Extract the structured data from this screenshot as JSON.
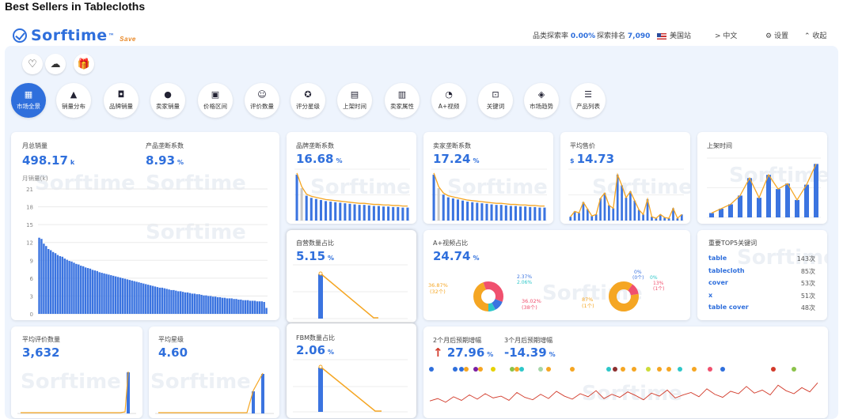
{
  "page": {
    "title": "Best Sellers in Tablecloths"
  },
  "header": {
    "logo_text": "Sorftime",
    "logo_tm": "™",
    "save_tag": "Save",
    "explore_rate_label": "品类探索率",
    "explore_rate_value": "0.00%",
    "explore_rank_label": "探索排名",
    "explore_rank_value": "7,090",
    "marketplace": "美国站",
    "language": "> 中文",
    "settings": "设置",
    "collapse": "收起"
  },
  "quick_icons": [
    "heart-icon",
    "cloud-upload-icon",
    "gift-icon"
  ],
  "nav": {
    "items": [
      {
        "label": "市场全景",
        "icon": "▦"
      },
      {
        "label": "销量分布",
        "icon": "▲"
      },
      {
        "label": "品牌销量",
        "icon": "◘"
      },
      {
        "label": "卖家销量",
        "icon": "●"
      },
      {
        "label": "价格区间",
        "icon": "▣"
      },
      {
        "label": "评价数量",
        "icon": "☺"
      },
      {
        "label": "评分星级",
        "icon": "✪"
      },
      {
        "label": "上架时间",
        "icon": "▤"
      },
      {
        "label": "卖家属性",
        "icon": "▥"
      },
      {
        "label": "A+视频",
        "icon": "◔"
      },
      {
        "label": "关键词",
        "icon": "⊡"
      },
      {
        "label": "市场趋势",
        "icon": "◈"
      },
      {
        "label": "产品列表",
        "icon": "☰"
      }
    ]
  },
  "monthly_sales": {
    "label": "月总销量",
    "value": "498.17",
    "unit": "k",
    "monopoly_label": "产品垄断系数",
    "monopoly_value": "8.93",
    "monopoly_unit": "%",
    "axis_title": "月销量(k)",
    "y_ticks": [
      "21",
      "18",
      "15",
      "12",
      "9",
      "6",
      "3",
      "0"
    ]
  },
  "brand_monopoly": {
    "label": "品牌垄断系数",
    "value": "16.68",
    "unit": "%"
  },
  "seller_monopoly": {
    "label": "卖家垄断系数",
    "value": "17.24",
    "unit": "%"
  },
  "avg_price": {
    "label": "平均售价",
    "currency": "$",
    "value": "14.73"
  },
  "listing_time": {
    "label": "上架时间"
  },
  "self_operated": {
    "label": "自营数量占比",
    "value": "5.15",
    "unit": "%"
  },
  "fbm": {
    "label": "FBM数量占比",
    "value": "2.06",
    "unit": "%"
  },
  "aplus": {
    "label": "A+视频占比",
    "value": "24.74",
    "unit": "%",
    "donut1": {
      "left_pct": "36.87%",
      "left_cnt": "(32个)",
      "right_pct": "36.02%",
      "right_cnt": "(38个)",
      "top_pct": "2.37%",
      "top_cnt": "(2个)",
      "top2_pct": "2.06%",
      "top2_cnt": "(2个)"
    },
    "donut2": {
      "left_pct": "87%",
      "left_cnt": "(1个)",
      "top_pct": "0%",
      "top_cnt": "(0个)",
      "top_r": "0%",
      "top_r_cnt": "(0个)",
      "right_pct": "13%",
      "right_cnt": "(1个)"
    }
  },
  "top_keywords": {
    "label": "重要TOP5关键词",
    "items": [
      {
        "kw": "table",
        "count": "143次"
      },
      {
        "kw": "tablecloth",
        "count": "85次"
      },
      {
        "kw": "cover",
        "count": "53次"
      },
      {
        "kw": "x",
        "count": "51次"
      },
      {
        "kw": "table cover",
        "count": "48次"
      }
    ]
  },
  "avg_reviews": {
    "label": "平均评价数量",
    "value": "3,632"
  },
  "avg_rating": {
    "label": "平均星级",
    "value": "4.60"
  },
  "growth": {
    "label2": "2个月后预期增幅",
    "value2": "27.96",
    "unit2": "%",
    "arrow": "↑",
    "label3": "3个月后预期增幅",
    "value3": "-14.39",
    "unit3": "%"
  },
  "watermark": "Sorftime",
  "colors": {
    "accent": "#2f6fdc",
    "bar": "#3b74e0",
    "line": "#f5a623",
    "red": "#d23a2a",
    "panel": "#eef4fd"
  },
  "chart_data": [
    {
      "type": "bar",
      "title": "月总销量",
      "ylabel": "月销量(k)",
      "ylim": [
        0,
        21
      ],
      "values": [
        12.8,
        12.6,
        11.8,
        11.4,
        10.9,
        10.7,
        10.4,
        10.2,
        9.9,
        9.7,
        9.6,
        9.3,
        9.1,
        8.9,
        8.8,
        8.6,
        8.4,
        8.3,
        8.1,
        8.0,
        7.8,
        7.7,
        7.6,
        7.4,
        7.3,
        7.2,
        7.0,
        6.9,
        6.8,
        6.7,
        6.6,
        6.5,
        6.4,
        6.3,
        6.2,
        6.1,
        6.0,
        5.9,
        5.8,
        5.7,
        5.6,
        5.5,
        5.4,
        5.3,
        5.2,
        5.1,
        5.0,
        4.9,
        4.8,
        4.7,
        4.6,
        4.5,
        4.4,
        4.4,
        4.3,
        4.2,
        4.1,
        4.0,
        4.0,
        3.9,
        3.8,
        3.8,
        3.7,
        3.6,
        3.6,
        3.5,
        3.4,
        3.4,
        3.3,
        3.3,
        3.2,
        3.1,
        3.1,
        3.0,
        3.0,
        2.9,
        2.9,
        2.8,
        2.8,
        2.7,
        2.7,
        2.6,
        2.6,
        2.6,
        2.5,
        2.5,
        2.4,
        2.4,
        2.3,
        2.3,
        2.3,
        2.2,
        2.2,
        2.2,
        2.1,
        2.1,
        2.1,
        2.0,
        1.0
      ]
    },
    {
      "type": "bar",
      "title": "品牌垄断系数",
      "values": [
        8.5,
        6.0,
        4.6,
        4.2,
        4.0,
        3.8,
        3.6,
        3.5,
        3.4,
        3.3,
        3.2,
        3.1,
        3.0,
        2.9,
        2.9,
        2.8,
        2.7,
        2.7,
        2.6,
        2.6,
        2.5,
        2.5,
        2.4,
        2.4
      ]
    },
    {
      "type": "bar",
      "title": "卖家垄断系数",
      "values": [
        8.5,
        6.0,
        4.8,
        4.3,
        4.1,
        3.9,
        3.7,
        3.5,
        3.4,
        3.3,
        3.2,
        3.1,
        3.0,
        2.9,
        2.9,
        2.8,
        2.7,
        2.7,
        2.6,
        2.6,
        2.5,
        2.5,
        2.4,
        2.4
      ]
    },
    {
      "type": "bar",
      "title": "平均售价",
      "values": [
        0.5,
        1.2,
        1.0,
        2.4,
        1.5,
        0.6,
        0.8,
        2.9,
        3.6,
        2.0,
        1.6,
        6.0,
        4.6,
        3.0,
        3.8,
        2.6,
        1.4,
        0.8,
        2.8,
        0.5,
        0.3,
        0.8,
        0.4,
        0.3,
        1.6,
        0.3,
        0.8
      ]
    },
    {
      "type": "bar",
      "title": "上架时间",
      "values": [
        0.4,
        0.8,
        1.2,
        2.0,
        3.6,
        1.8,
        3.9,
        2.6,
        3.1,
        1.6,
        3.0,
        4.9
      ]
    },
    {
      "type": "line",
      "title": "2个月后预期增幅",
      "values": [
        1.8,
        2.2,
        1.6,
        2.5,
        1.9,
        2.8,
        2.1,
        3.0,
        2.3,
        2.6,
        1.9,
        3.2,
        2.4,
        2.0,
        2.9,
        2.2,
        3.4,
        2.6,
        2.1,
        3.0,
        2.5,
        3.5,
        2.2,
        2.9,
        2.4,
        3.3,
        2.7,
        2.0,
        3.1,
        2.6,
        3.6,
        2.3,
        2.8,
        3.2,
        2.5,
        3.8,
        2.9,
        2.4,
        3.4,
        3.0,
        4.2,
        3.1,
        3.6,
        2.8,
        4.4,
        3.5,
        3.0,
        4.0,
        3.3,
        4.8
      ]
    }
  ]
}
